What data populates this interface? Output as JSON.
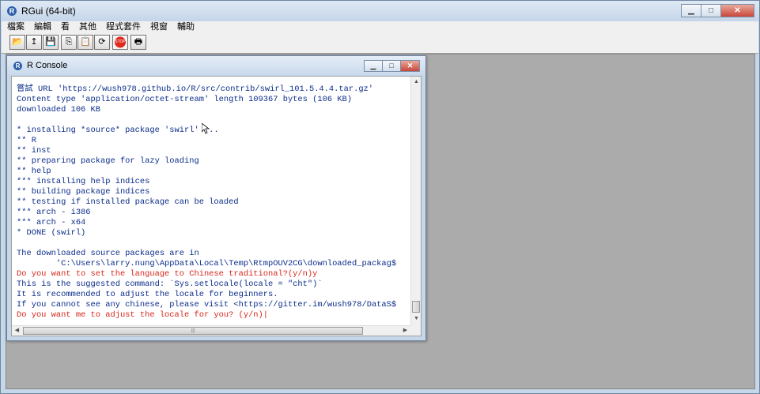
{
  "app": {
    "title": "RGui (64-bit)",
    "logo_letter": "R",
    "window_buttons": {
      "minimize": "▁",
      "maximize": "□",
      "close": "✕"
    }
  },
  "menu": [
    "檔案",
    "編輯",
    "看",
    "其他",
    "程式套件",
    "視窗",
    "輔助"
  ],
  "toolbar": [
    {
      "name": "open-script",
      "icon": "folder-open-icon",
      "glyph": "📂"
    },
    {
      "name": "load-workspace",
      "icon": "load-icon",
      "glyph": "↥"
    },
    {
      "name": "save-workspace",
      "icon": "save-icon",
      "glyph": "💾"
    },
    {
      "name": "copy",
      "icon": "copy-icon",
      "glyph": "⎘"
    },
    {
      "name": "paste",
      "icon": "paste-icon",
      "glyph": "📋"
    },
    {
      "name": "copy-paste",
      "icon": "refresh-icon",
      "glyph": "⟳"
    },
    {
      "name": "stop",
      "icon": "stop-icon",
      "glyph": "STOP"
    },
    {
      "name": "print",
      "icon": "print-icon",
      "glyph": "🖶"
    }
  ],
  "console": {
    "title": "R Console",
    "logo_letter": "R",
    "lines": [
      {
        "text": "嘗試 URL 'https://wush978.github.io/R/src/contrib/swirl_101.5.4.4.tar.gz'",
        "red": false
      },
      {
        "text": "Content type 'application/octet-stream' length 109367 bytes (106 KB)",
        "red": false
      },
      {
        "text": "downloaded 106 KB",
        "red": false
      },
      {
        "text": "",
        "red": false
      },
      {
        "text": "* installing *source* package 'swirl' ...",
        "red": false
      },
      {
        "text": "** R",
        "red": false
      },
      {
        "text": "** inst",
        "red": false
      },
      {
        "text": "** preparing package for lazy loading",
        "red": false
      },
      {
        "text": "** help",
        "red": false
      },
      {
        "text": "*** installing help indices",
        "red": false
      },
      {
        "text": "** building package indices",
        "red": false
      },
      {
        "text": "** testing if installed package can be loaded",
        "red": false
      },
      {
        "text": "*** arch - i386",
        "red": false
      },
      {
        "text": "*** arch - x64",
        "red": false
      },
      {
        "text": "* DONE (swirl)",
        "red": false
      },
      {
        "text": "",
        "red": false
      },
      {
        "text": "The downloaded source packages are in",
        "red": false
      },
      {
        "text": "        'C:\\Users\\larry.nung\\AppData\\Local\\Temp\\RtmpOUV2CG\\downloaded_packag$",
        "red": false
      },
      {
        "text": "Do you want to set the language to Chinese traditional?(y/n)y",
        "red": true
      },
      {
        "text": "This is the suggested command: `Sys.setlocale(locale = \"cht\")`",
        "red": false
      },
      {
        "text": "It is recommended to adjust the locale for beginners.",
        "red": false
      },
      {
        "text": "If you cannot see any chinese, please visit <https://gitter.im/wush978/DataS$",
        "red": false
      },
      {
        "text": "Do you want me to adjust the locale for you? (y/n)|",
        "red": true
      }
    ],
    "scroll": {
      "up": "▲",
      "down": "▼",
      "left": "◀",
      "right": "▶",
      "grip": "|||"
    }
  },
  "colors": {
    "output_text": "#0b2d8a",
    "input_text": "#d8261a",
    "mdi_background": "#ababab"
  }
}
